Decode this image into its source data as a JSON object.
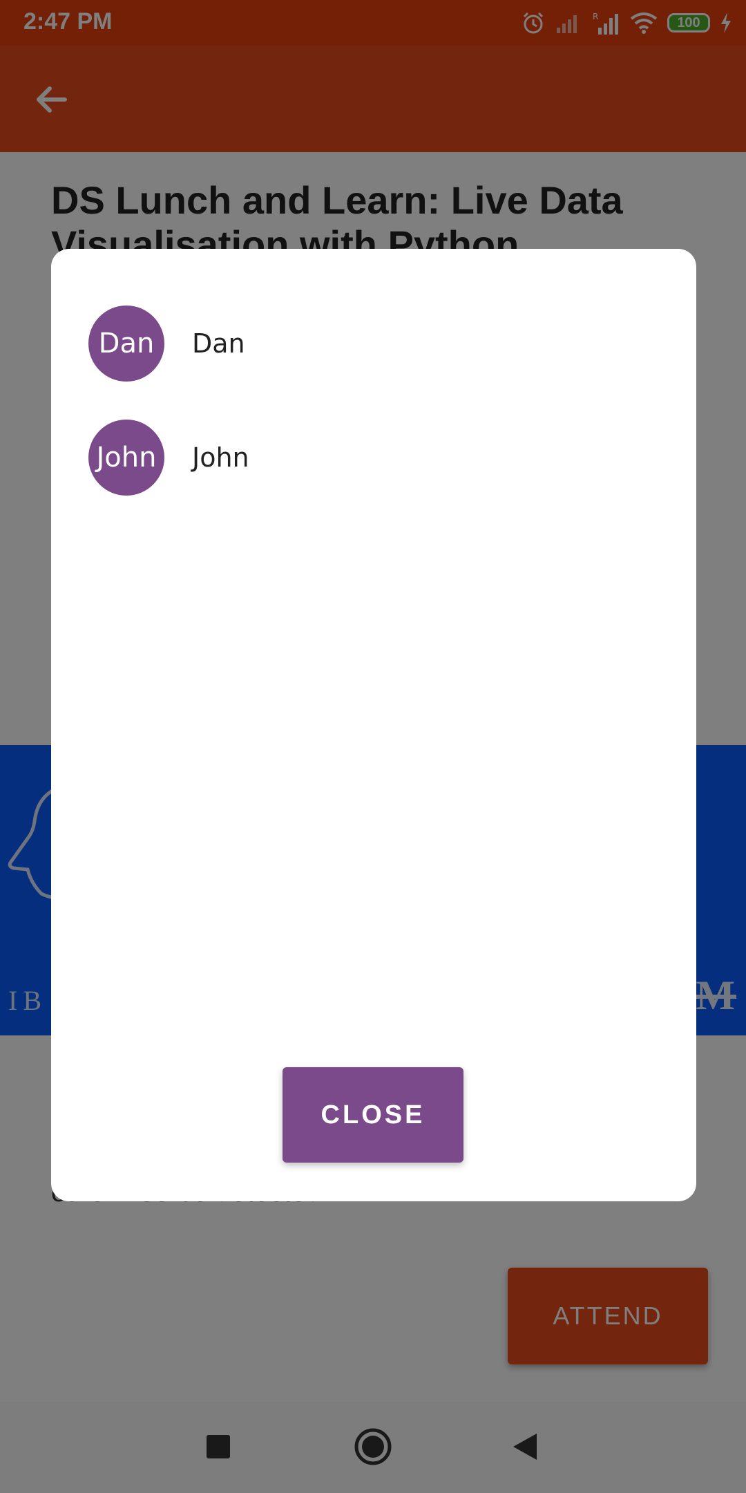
{
  "status_bar": {
    "time": "2:47 PM",
    "battery": "100"
  },
  "event": {
    "title": "DS Lunch and Learn: Live Data Visualisation with Python",
    "description": "otherwise be detected."
  },
  "banner": {
    "logo_left": "IB",
    "logo_right": "M"
  },
  "attendees_dialog": {
    "attendees": [
      {
        "initials": "Dan",
        "name": "Dan"
      },
      {
        "initials": "John",
        "name": "John"
      }
    ],
    "close_label": "CLOSE",
    "accent_color": "#7A4A8B"
  },
  "attend_label": "ATTEND",
  "colors": {
    "app_bar": "#E84B1A",
    "status_bar": "#E8410F",
    "banner": "#0D5CFF"
  },
  "icons": {
    "back": "arrow-left-icon",
    "nav_recent": "square-icon",
    "nav_home": "circle-icon",
    "nav_back": "triangle-back-icon"
  }
}
